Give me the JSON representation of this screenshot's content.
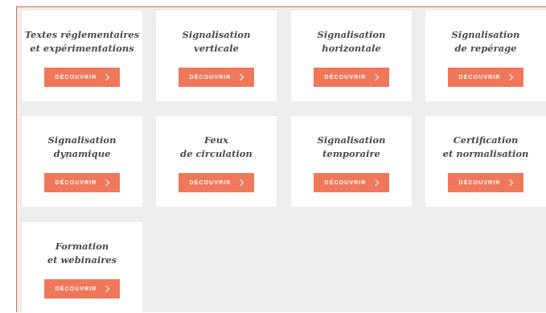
{
  "cards": [
    {
      "title": "Textes réglementaires\net expérimentations",
      "button": "DÉCOUVRIR"
    },
    {
      "title": "Signalisation\nverticale",
      "button": "DÉCOUVRIR"
    },
    {
      "title": "Signalisation\nhorizontale",
      "button": "DÉCOUVRIR"
    },
    {
      "title": "Signalisation\nde repérage",
      "button": "DÉCOUVRIR"
    },
    {
      "title": "Signalisation\ndynamique",
      "button": "DÉCOUVRIR"
    },
    {
      "title": "Feux\nde circulation",
      "button": "DÉCOUVRIR"
    },
    {
      "title": "Signalisation\ntemporaire",
      "button": "DÉCOUVRIR"
    },
    {
      "title": "Certification\net normalisation",
      "button": "DÉCOUVRIR"
    },
    {
      "title": "Formation\net webinaires",
      "button": "DÉCOUVRIR"
    }
  ],
  "colors": {
    "accent": "#f0785a",
    "border": "#e8674c",
    "background": "#eeeeee",
    "card": "#ffffff",
    "title": "#4a4a4a"
  },
  "icons": {
    "button_arrow": "chevron-right-icon"
  }
}
